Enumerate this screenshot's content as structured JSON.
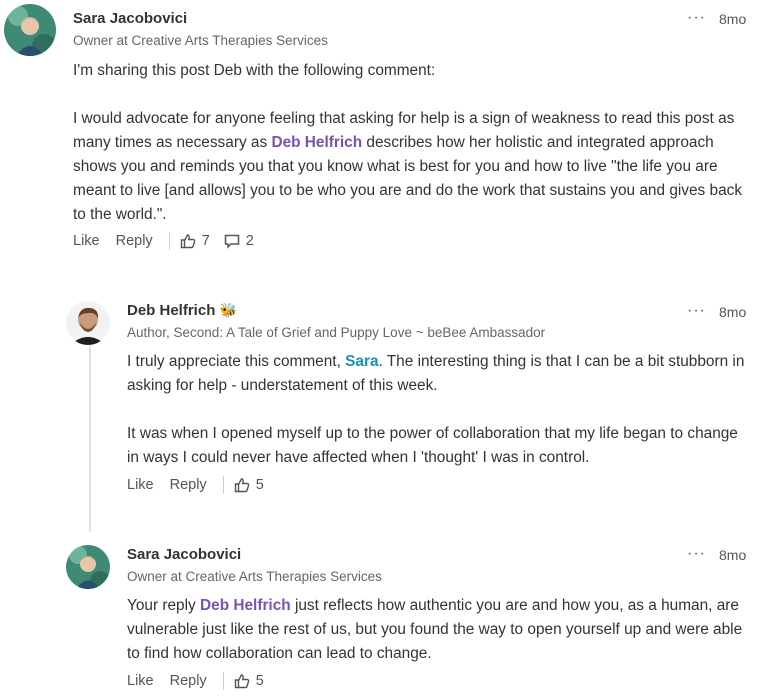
{
  "comment1": {
    "author": "Sara Jacobovici",
    "subtitle": "Owner at Creative Arts Therapies Services",
    "time": "8mo",
    "p1": "I'm sharing this post Deb with the following comment:",
    "p2_before": "I would advocate for anyone feeling that asking for help is a sign of weakness to read this post as many times as necessary as ",
    "p2_mention": "Deb Helfrich",
    "p2_after": " describes how her holistic and integrated approach shows you and reminds you that you know what is best for you and how to live \"the life you are meant to live [and allows] you to be who you are and do the work that sustains you and gives back to the world.\".",
    "like": "Like",
    "reply": "Reply",
    "likes_count": "7",
    "comments_count": "2"
  },
  "reply1": {
    "author": "Deb Helfrich",
    "badge": "🐝",
    "subtitle": "Author, Second: A Tale of Grief and Puppy Love ~ beBee Ambassador",
    "time": "8mo",
    "p1_before": "I truly appreciate this comment, ",
    "p1_mention": "Sara",
    "p1_after": ". The interesting thing is that I can be a bit stubborn in asking for help - understatement of this week.",
    "p2": "It was when I opened myself up to the power of collaboration that my life began to change in ways I could never have affected when I 'thought' I was in control.",
    "like": "Like",
    "reply": "Reply",
    "likes_count": "5"
  },
  "reply2": {
    "author": "Sara Jacobovici",
    "subtitle": "Owner at Creative Arts Therapies Services",
    "time": "8mo",
    "p1_before": "Your reply ",
    "p1_mention": "Deb Helfrich",
    "p1_after": " just reflects how authentic you are and how you, as a human, are vulnerable just like the rest of us, but you found the way to open yourself up and were able to find how collaboration can lead to change.",
    "like": "Like",
    "reply": "Reply",
    "likes_count": "5"
  },
  "icons": {
    "more": "more-options-icon",
    "thumbs_up": "thumbs-up-icon",
    "comment": "comment-icon"
  }
}
